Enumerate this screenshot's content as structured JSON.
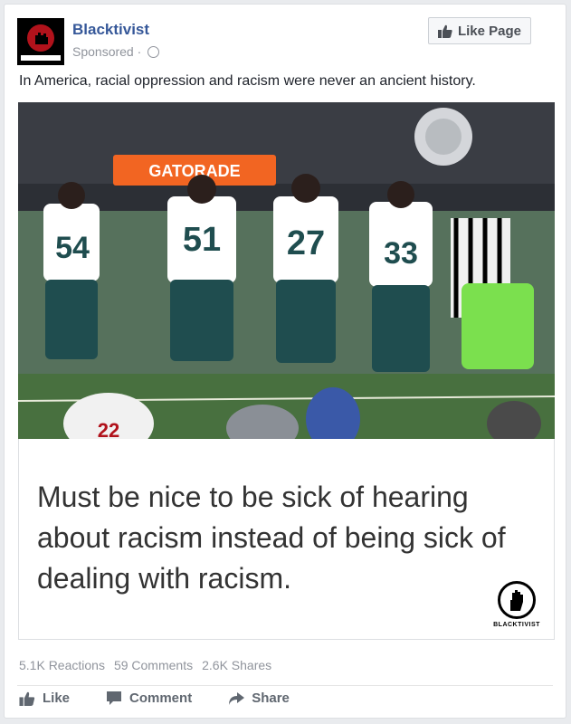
{
  "post": {
    "page_name": "Blacktivist",
    "sponsored_label": "Sponsored ·",
    "like_page_label": "Like Page",
    "text": "In America, racial oppression and racism were never an ancient history."
  },
  "image": {
    "signage": "GATORADE",
    "jersey_numbers": [
      "54",
      "51",
      "27",
      "33",
      "22"
    ],
    "quote": "Must be nice to be sick of hearing about racism instead of being sick of dealing with racism.",
    "brand_mark": "BLACKTIVIST"
  },
  "stats": {
    "reactions": "5.1K Reactions",
    "comments": "59 Comments",
    "shares": "2.6K Shares"
  },
  "actions": {
    "like": "Like",
    "comment": "Comment",
    "share": "Share"
  },
  "colors": {
    "link": "#365899",
    "jersey": "#ffffff",
    "pants": "#1f4d4f",
    "sign": "#f26522",
    "vest": "#7be04e"
  }
}
